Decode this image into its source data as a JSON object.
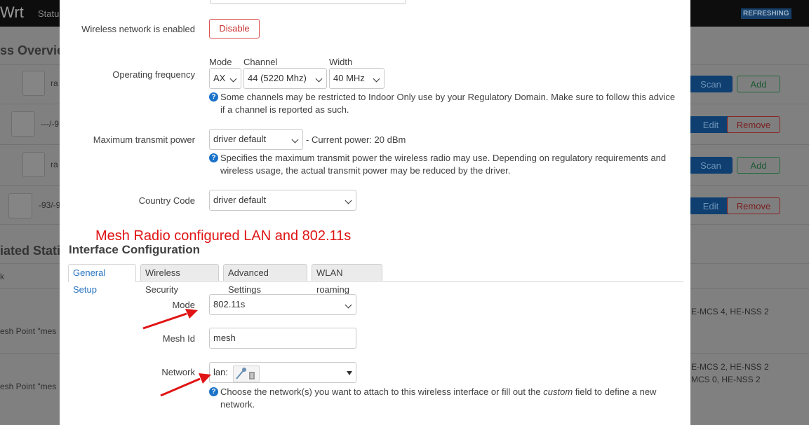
{
  "background": {
    "brand": "Wrt",
    "nav_item": "Statu",
    "refresh_badge": "REFRESHING",
    "overview_title": "ss Overvie",
    "stations_title": "iated Stati",
    "col_header": "k",
    "rows": [
      {
        "text": "ra",
        "btn1": "Scan",
        "btn2": "Add"
      },
      {
        "text": "---/-9",
        "btn1": "Edit",
        "btn2": "Remove"
      },
      {
        "text": "ra",
        "btn1": "Scan",
        "btn2": "Add"
      },
      {
        "text": "-93/-9",
        "btn1": "Edit",
        "btn2": "Remove"
      }
    ],
    "stations": [
      {
        "name": "esh Point \"mes",
        "stat1": "E-MCS 4, HE-NSS 2",
        "stat2": ""
      },
      {
        "name": "esh Point \"mes",
        "stat1": "E-MCS 2, HE-NSS 2",
        "stat2": "MCS 0, HE-NSS 2"
      }
    ]
  },
  "modal": {
    "wireless_enabled": {
      "label": "Wireless network is enabled",
      "button": "Disable"
    },
    "operating_frequency": {
      "label": "Operating frequency",
      "mode_label": "Mode",
      "channel_label": "Channel",
      "width_label": "Width",
      "mode_value": "AX",
      "channel_value": "44 (5220 Mhz)",
      "width_value": "40 MHz",
      "help": "Some channels may be restricted to Indoor Only use by your Regulatory Domain. Make sure to follow this advice",
      "help2": "if a channel is reported as such."
    },
    "tx_power": {
      "label": "Maximum transmit power",
      "value": "driver default",
      "current": "- Current power: 20 dBm",
      "help": "Specifies the maximum transmit power the wireless radio may use. Depending on regulatory requirements and",
      "help2": "wireless usage, the actual transmit power may be reduced by the driver."
    },
    "country_code": {
      "label": "Country Code",
      "value": "driver default"
    },
    "annotation": "Mesh Radio configured LAN and 802.11s",
    "interface_title": "Interface Configuration",
    "tabs": [
      "General Setup",
      "Wireless Security",
      "Advanced Settings",
      "WLAN roaming"
    ],
    "mode": {
      "label": "Mode",
      "value": "802.11s"
    },
    "mesh_id": {
      "label": "Mesh Id",
      "value": "mesh"
    },
    "network": {
      "label": "Network",
      "value": "lan:",
      "help_pre": "Choose the network(s) you want to attach to this wireless interface or fill out the ",
      "help_em": "custom",
      "help_post": " field to define a new",
      "help2": "network."
    },
    "colors": {
      "accent": "#2a75c0",
      "danger": "#d9534f",
      "annotation": "#e01414"
    }
  }
}
